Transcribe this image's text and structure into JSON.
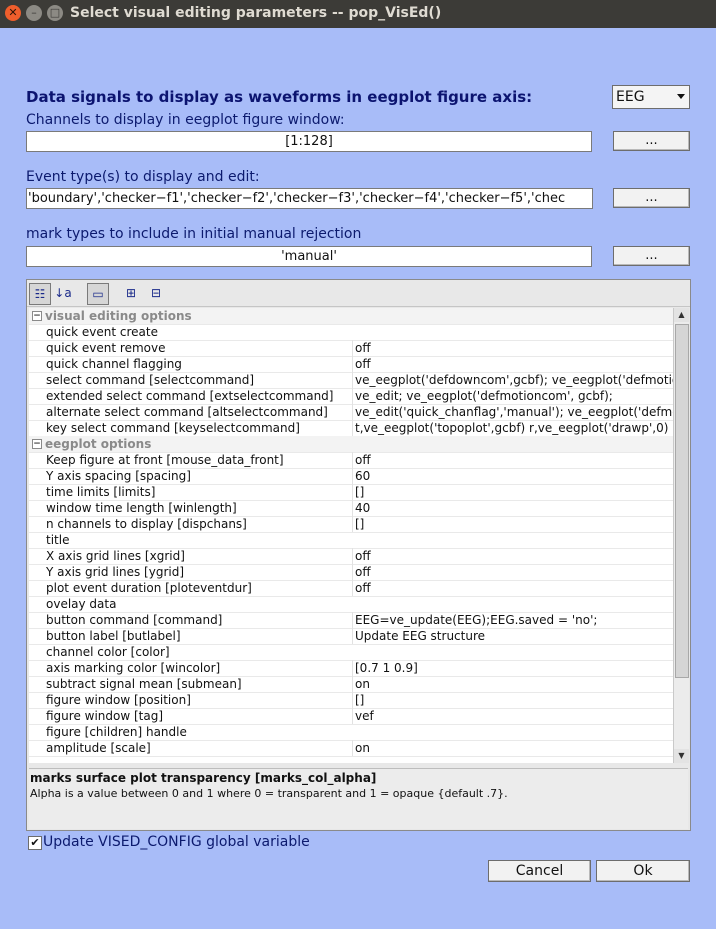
{
  "window": {
    "title": "Select visual editing parameters -- pop_VisEd()"
  },
  "data_signals": {
    "label": "Data signals to display as waveforms in eegplot figure axis:",
    "selected": "EEG"
  },
  "channels": {
    "label": "Channels to display in eegplot figure window:",
    "value": "[1:128]",
    "button": "..."
  },
  "events": {
    "label": "Event type(s) to display and edit:",
    "value": "'boundary','checker−f1','checker−f2','checker−f3','checker−f4','checker−f5','chec",
    "button": "..."
  },
  "marks": {
    "label": "mark types to include in initial manual rejection",
    "value": "'manual'",
    "button": "..."
  },
  "toolbar_icons": [
    "categorized-icon",
    "sort-alpha-icon",
    "description-icon",
    "expand-all-icon",
    "collapse-all-icon"
  ],
  "properties": [
    {
      "type": "cat",
      "label": "visual editing options"
    },
    {
      "label": "quick event create",
      "value": ""
    },
    {
      "label": "quick event remove",
      "value": "off"
    },
    {
      "label": "quick channel flagging",
      "value": "off"
    },
    {
      "label": "select command [selectcommand]",
      "value": "ve_eegplot('defdowncom',gcbf); ve_eegplot('defmotionc"
    },
    {
      "label": "extended select command [extselectcommand]",
      "value": "ve_edit; ve_eegplot('defmotioncom', gcbf);"
    },
    {
      "label": "alternate select command [altselectcommand]",
      "value": "ve_edit('quick_chanflag','manual'); ve_eegplot('defmotic"
    },
    {
      "label": "key select command [keyselectcommand]",
      "value": "t,ve_eegplot('topoplot',gcbf) r,ve_eegplot('drawp',0)"
    },
    {
      "type": "cat",
      "label": "eegplot options"
    },
    {
      "label": "Keep figure at front [mouse_data_front]",
      "value": "off"
    },
    {
      "label": "Y axis spacing [spacing]",
      "value": "60"
    },
    {
      "label": "time limits [limits]",
      "value": "[]"
    },
    {
      "label": "window time length [winlength]",
      "value": "40"
    },
    {
      "label": "n channels to display [dispchans]",
      "value": "[]"
    },
    {
      "label": "title",
      "value": ""
    },
    {
      "label": "X axis grid lines [xgrid]",
      "value": "off"
    },
    {
      "label": "Y axis grid lines [ygrid]",
      "value": "off"
    },
    {
      "label": "plot event duration [ploteventdur]",
      "value": "off"
    },
    {
      "label": "ovelay data",
      "value": ""
    },
    {
      "label": "button command [command]",
      "value": "EEG=ve_update(EEG);EEG.saved = 'no';"
    },
    {
      "label": "button label [butlabel]",
      "value": "Update EEG structure"
    },
    {
      "label": "channel color [color]",
      "value": ""
    },
    {
      "label": "axis marking color [wincolor]",
      "value": "[0.7 1 0.9]"
    },
    {
      "label": "subtract signal mean [submean]",
      "value": "on"
    },
    {
      "label": "figure window [position]",
      "value": "[]"
    },
    {
      "label": "figure window [tag]",
      "value": "vef"
    },
    {
      "label": "figure [children] handle",
      "value": ""
    },
    {
      "label": "amplitude [scale]",
      "value": "on"
    }
  ],
  "description": {
    "title": "marks surface plot transparency [marks_col_alpha]",
    "text": "Alpha is a value between 0 and 1 where 0 = transparent and 1 = opaque {default .7}."
  },
  "update_config": {
    "label": "Update VISED_CONFIG global variable",
    "checked": true
  },
  "buttons": {
    "cancel": "Cancel",
    "ok": "Ok"
  }
}
